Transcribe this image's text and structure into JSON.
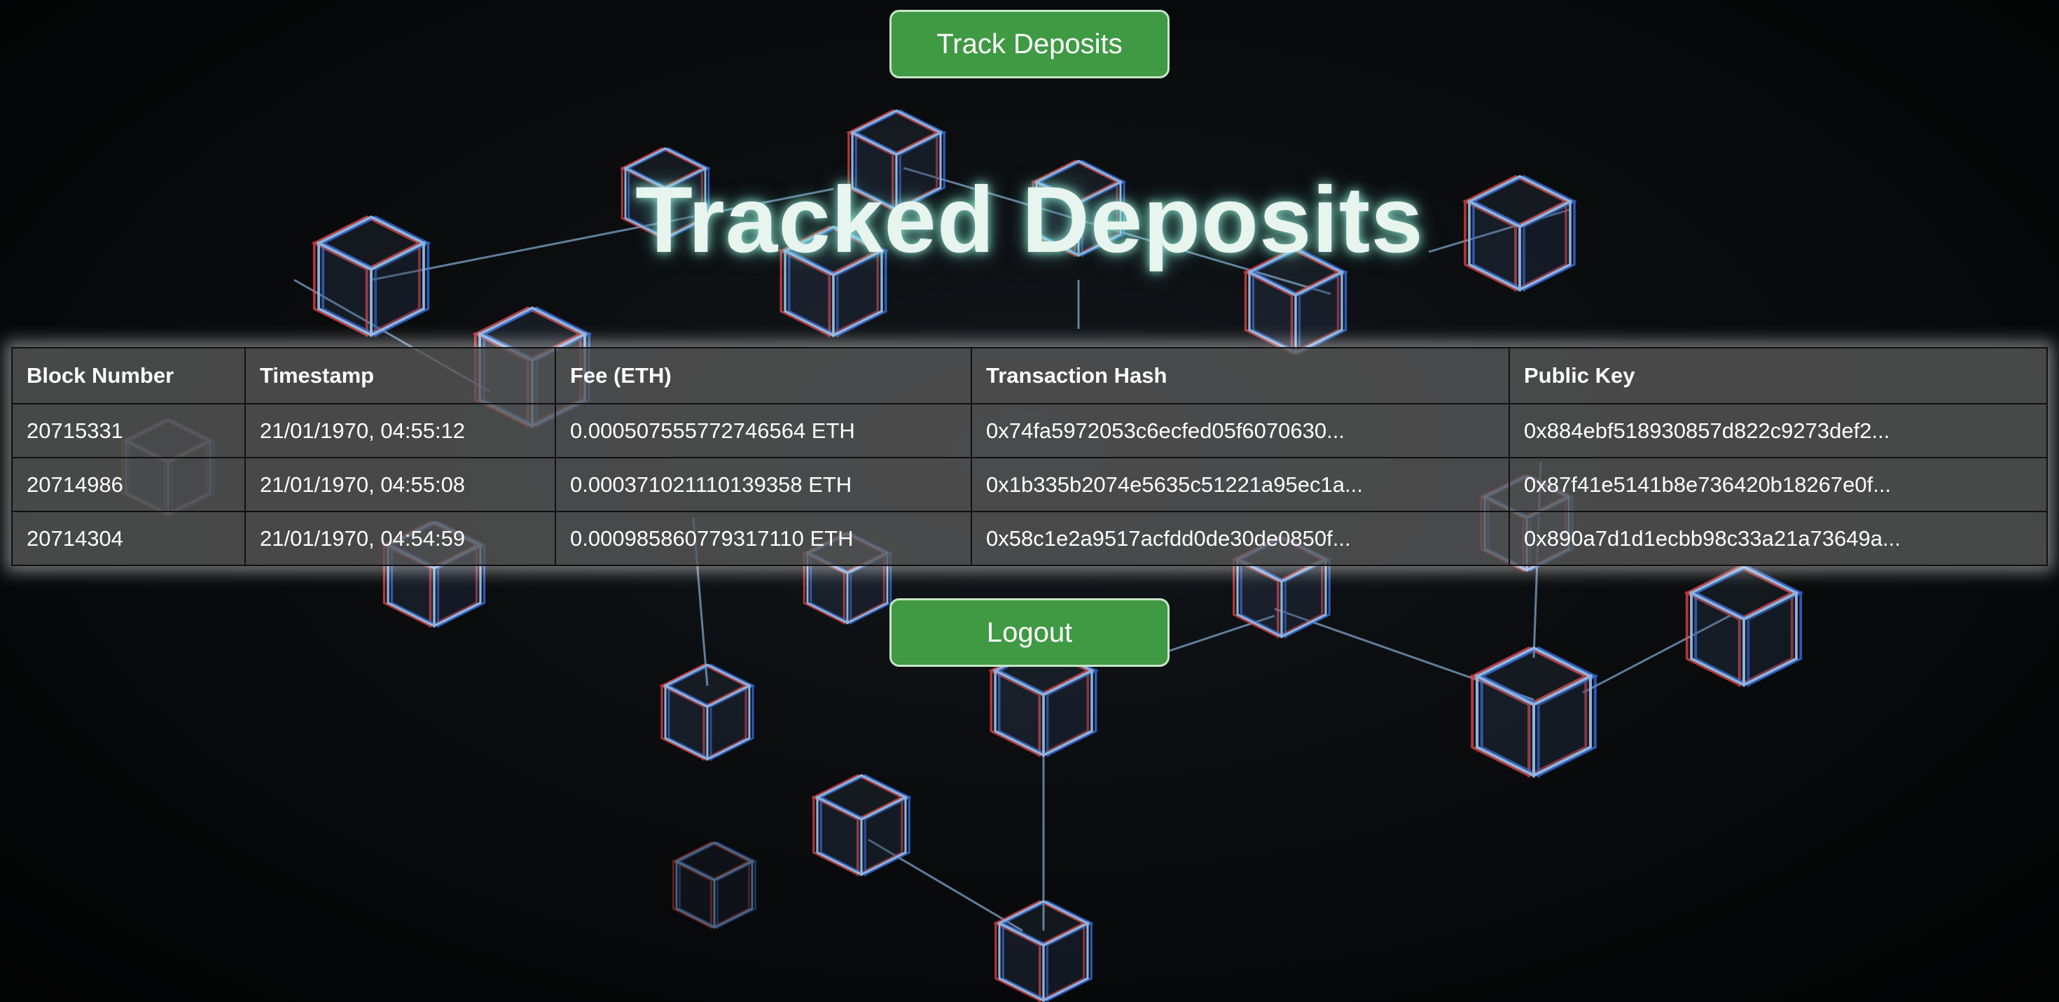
{
  "header": {
    "track_button_label": "Track Deposits"
  },
  "page": {
    "title": "Tracked Deposits"
  },
  "table": {
    "columns": [
      "Block Number",
      "Timestamp",
      "Fee (ETH)",
      "Transaction Hash",
      "Public Key"
    ],
    "rows": [
      [
        "20715331",
        "21/01/1970, 04:55:12",
        "0.000507555772746564 ETH",
        "0x74fa5972053c6ecfed05f6070630...",
        "0x884ebf518930857d822c9273def2..."
      ],
      [
        "20714986",
        "21/01/1970, 04:55:08",
        "0.000371021110139358 ETH",
        "0x1b335b2074e5635c51221a95ec1a...",
        "0x87f41e5141b8e736420b18267e0f..."
      ],
      [
        "20714304",
        "21/01/1970, 04:54:59",
        "0.000985860779317110 ETH",
        "0x58c1e2a9517acfdd0de30de0850f...",
        "0x890a7d1d1ecbb98c33a21a73649a..."
      ]
    ]
  },
  "footer": {
    "logout_button_label": "Logout"
  },
  "colors": {
    "button_green": "#3f9a43",
    "title_glow": "#a0ffe6",
    "table_bg": "#5a5a5a"
  }
}
